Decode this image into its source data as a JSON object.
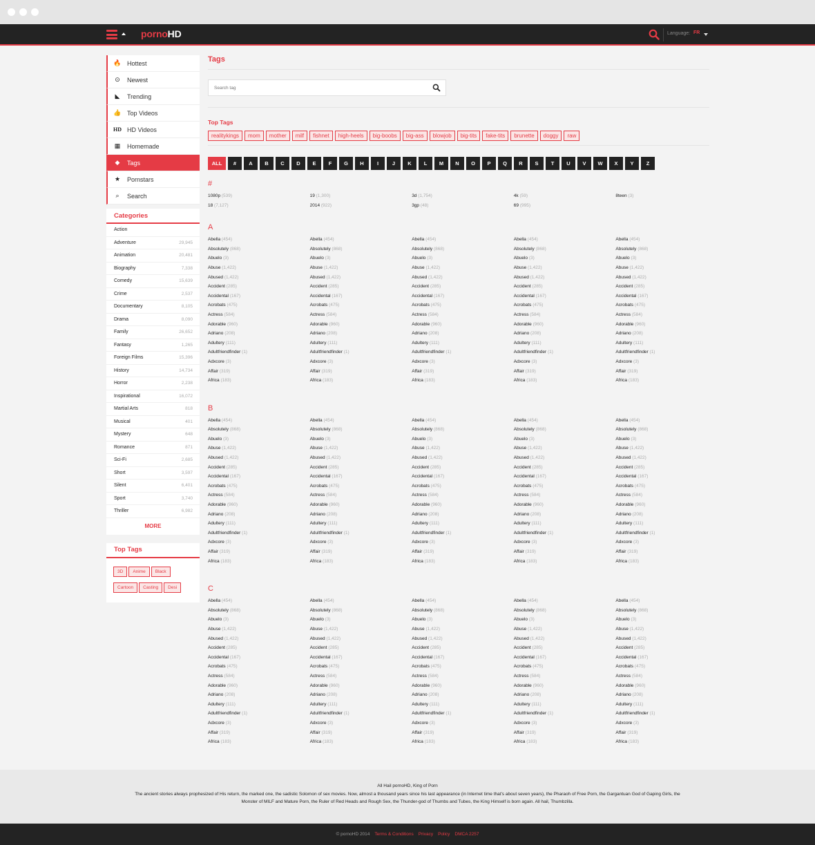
{
  "header": {
    "logo_a": "porno",
    "logo_b": "HD",
    "language_label": "Language:",
    "language_value": "FR"
  },
  "nav": [
    {
      "label": "Hottest",
      "icon": "flame-icon",
      "glyph": "🔥"
    },
    {
      "label": "Newest",
      "icon": "clock-icon",
      "glyph": "⊙"
    },
    {
      "label": "Trending",
      "icon": "area-chart-icon",
      "glyph": "◣"
    },
    {
      "label": "Top Videos",
      "icon": "thumbs-up-icon",
      "glyph": "👍"
    },
    {
      "label": "HD Videos",
      "icon": "hd-icon",
      "glyph": "HD"
    },
    {
      "label": "Homemade",
      "icon": "film-icon",
      "glyph": "▦"
    },
    {
      "label": "Tags",
      "icon": "tag-icon",
      "glyph": "◆",
      "active": true
    },
    {
      "label": "Pornstars",
      "icon": "star-icon",
      "glyph": "★"
    },
    {
      "label": "Search",
      "icon": "search-icon",
      "glyph": "⌕"
    }
  ],
  "categories": {
    "title": "Categories",
    "items": [
      {
        "name": "Action",
        "count": ""
      },
      {
        "name": "Adventure",
        "count": "29,945"
      },
      {
        "name": "Animation",
        "count": "20,481"
      },
      {
        "name": "Biography",
        "count": "7,338"
      },
      {
        "name": "Comedy",
        "count": "15,639"
      },
      {
        "name": "Crime",
        "count": "2,537"
      },
      {
        "name": "Documentary",
        "count": "8,105"
      },
      {
        "name": "Drama",
        "count": "8,090"
      },
      {
        "name": "Family",
        "count": "26,652"
      },
      {
        "name": "Fantasy",
        "count": "1,265"
      },
      {
        "name": "Foreign Films",
        "count": "15,396"
      },
      {
        "name": "History",
        "count": "14,734"
      },
      {
        "name": "Horror",
        "count": "2,238"
      },
      {
        "name": "Inspirational",
        "count": "16,072"
      },
      {
        "name": "Martial Arts",
        "count": "818"
      },
      {
        "name": "Musical",
        "count": "401"
      },
      {
        "name": "Mystery",
        "count": "648"
      },
      {
        "name": "Romance",
        "count": "871"
      },
      {
        "name": "Sci-Fi",
        "count": "2,685"
      },
      {
        "name": "Short",
        "count": "3,597"
      },
      {
        "name": "Silent",
        "count": "6,401"
      },
      {
        "name": "Sport",
        "count": "3,740"
      },
      {
        "name": "Thriller",
        "count": "6,982"
      }
    ],
    "more": "MORE"
  },
  "side_top_tags": {
    "title": "Top Tags",
    "tags": [
      "3D",
      "Anime",
      "Black",
      "Cartoon",
      "Casting",
      "Desi"
    ]
  },
  "main": {
    "title": "Tags",
    "search_placeholder": "Search tag",
    "top_tags_title": "Top Tags",
    "top_tags": [
      "realitykings",
      "mom",
      "mother",
      "milf",
      "fishnet",
      "high-heels",
      "big-boobs",
      "big-ass",
      "blowjob",
      "big-tits",
      "fake-tits",
      "brunette",
      "doggy",
      "raw"
    ],
    "letters": [
      "ALL",
      "#",
      "A",
      "B",
      "C",
      "D",
      "E",
      "F",
      "G",
      "H",
      "I",
      "J",
      "K",
      "L",
      "M",
      "N",
      "O",
      "P",
      "Q",
      "R",
      "S",
      "T",
      "U",
      "V",
      "W",
      "X",
      "Y",
      "Z"
    ],
    "hash_section": {
      "heading": "#",
      "rows": [
        [
          {
            "name": "1080p",
            "count": "(539)"
          },
          {
            "name": "19",
            "count": "(1,300)"
          },
          {
            "name": "3d",
            "count": "(1,754)"
          },
          {
            "name": "4k",
            "count": "(59)"
          },
          {
            "name": "8teen",
            "count": "(3)"
          }
        ],
        [
          {
            "name": "18",
            "count": "(7,127)"
          },
          {
            "name": "2014",
            "count": "(922)"
          },
          {
            "name": "3gp",
            "count": "(48)"
          },
          {
            "name": "69",
            "count": "(995)"
          },
          {
            "name": "",
            "count": ""
          }
        ]
      ]
    },
    "letter_sections": [
      "A",
      "B",
      "C"
    ],
    "tag_list": [
      {
        "name": "Abella",
        "count": "(454)"
      },
      {
        "name": "Absolutely",
        "count": "(868)"
      },
      {
        "name": "Abuelo",
        "count": "(3)"
      },
      {
        "name": "Abuse",
        "count": "(1,422)"
      },
      {
        "name": "Abused",
        "count": "(1,422)"
      },
      {
        "name": "Accident",
        "count": "(285)"
      },
      {
        "name": "Accidental",
        "count": "(167)"
      },
      {
        "name": "Acrobats",
        "count": "(475)"
      },
      {
        "name": "Actress",
        "count": "(584)"
      },
      {
        "name": "Adorable",
        "count": "(960)"
      },
      {
        "name": "Adriano",
        "count": "(208)"
      },
      {
        "name": "Adultery",
        "count": "(111)"
      },
      {
        "name": "Adultfriendfinder",
        "count": "(1)"
      },
      {
        "name": "Adxcore",
        "count": "(3)"
      },
      {
        "name": "Affair",
        "count": "(319)"
      },
      {
        "name": "Africa",
        "count": "(183)"
      }
    ],
    "columns": 5
  },
  "footer": {
    "line1": "All Hail pornoHD, King of Porn",
    "line2": "The ancient stories always prophesized of His return, the marked one, the sadistic Solomon of sex movies. Now, almost a thousand years since his last appearance (in Internet time that's about seven years), the Pharaoh of Free Porn, the Gargantuan God of Gaping Girls, the Monster of MILF and Mature Porn, the Ruler of Red Heads and Rough Sex, the Thunder-god of Thumbs and Tubes, the King Himself is born again. All hail, Thumbzilla.",
    "copyright": "© pornoHD 2014",
    "links": [
      "Terms & Conditions",
      "Privacy",
      "Policy",
      "DMCA 2257"
    ]
  },
  "colors": {
    "accent": "#e53b45",
    "dark": "#232323",
    "background": "#f3f3f3"
  }
}
